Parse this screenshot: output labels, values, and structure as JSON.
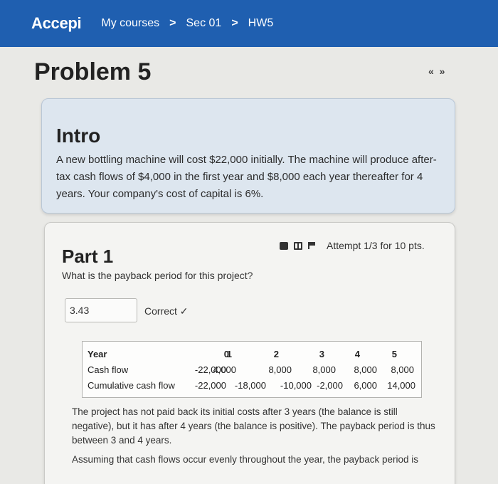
{
  "nav": {
    "brand": "Accepi",
    "breadcrumbs": [
      "My courses",
      "Sec 01",
      "HW5"
    ],
    "separator": ">"
  },
  "page": {
    "title": "Problem 5",
    "pager": "« »"
  },
  "intro": {
    "heading": "Intro",
    "text": "A new bottling machine will cost $22,000 initially. The machine will produce after-tax cash flows of $4,000 in the first year and $8,000 each year thereafter for 4 years. Your company's cost of capital is 6%."
  },
  "part1": {
    "heading": "Part 1",
    "attempt": "Attempt 1/3 for 10 pts.",
    "question": "What is the payback period for this project?",
    "answer_value": "3.43",
    "status": "Correct ✓",
    "table": {
      "header_label": "Year",
      "years": [
        "0",
        "1",
        "2",
        "3",
        "4",
        "5"
      ],
      "cash_flow_label": "Cash flow",
      "cash_flows": [
        "-22,000",
        "4,000",
        "8,000",
        "8,000",
        "8,000",
        "8,000"
      ],
      "cumulative_label": "Cumulative cash flow",
      "cumulative": [
        "-22,000",
        "-18,000",
        "-10,000",
        "-2,000",
        "6,000",
        "14,000"
      ]
    },
    "explanation": [
      "The project has not paid back its initial costs after 3 years (the balance is still negative), but it has after 4 years (the balance is positive). The payback period is thus between 3 and 4 years.",
      "Assuming that cash flows occur evenly throughout the year, the payback period is"
    ]
  },
  "colors": {
    "nav_bar": "#1f5fb0",
    "intro_card": "#dde6ef",
    "part_card": "#f4f4f2",
    "page_background": "#e9e9e6"
  },
  "icons": [
    "calculator-icon",
    "book-icon",
    "flag-icon"
  ]
}
